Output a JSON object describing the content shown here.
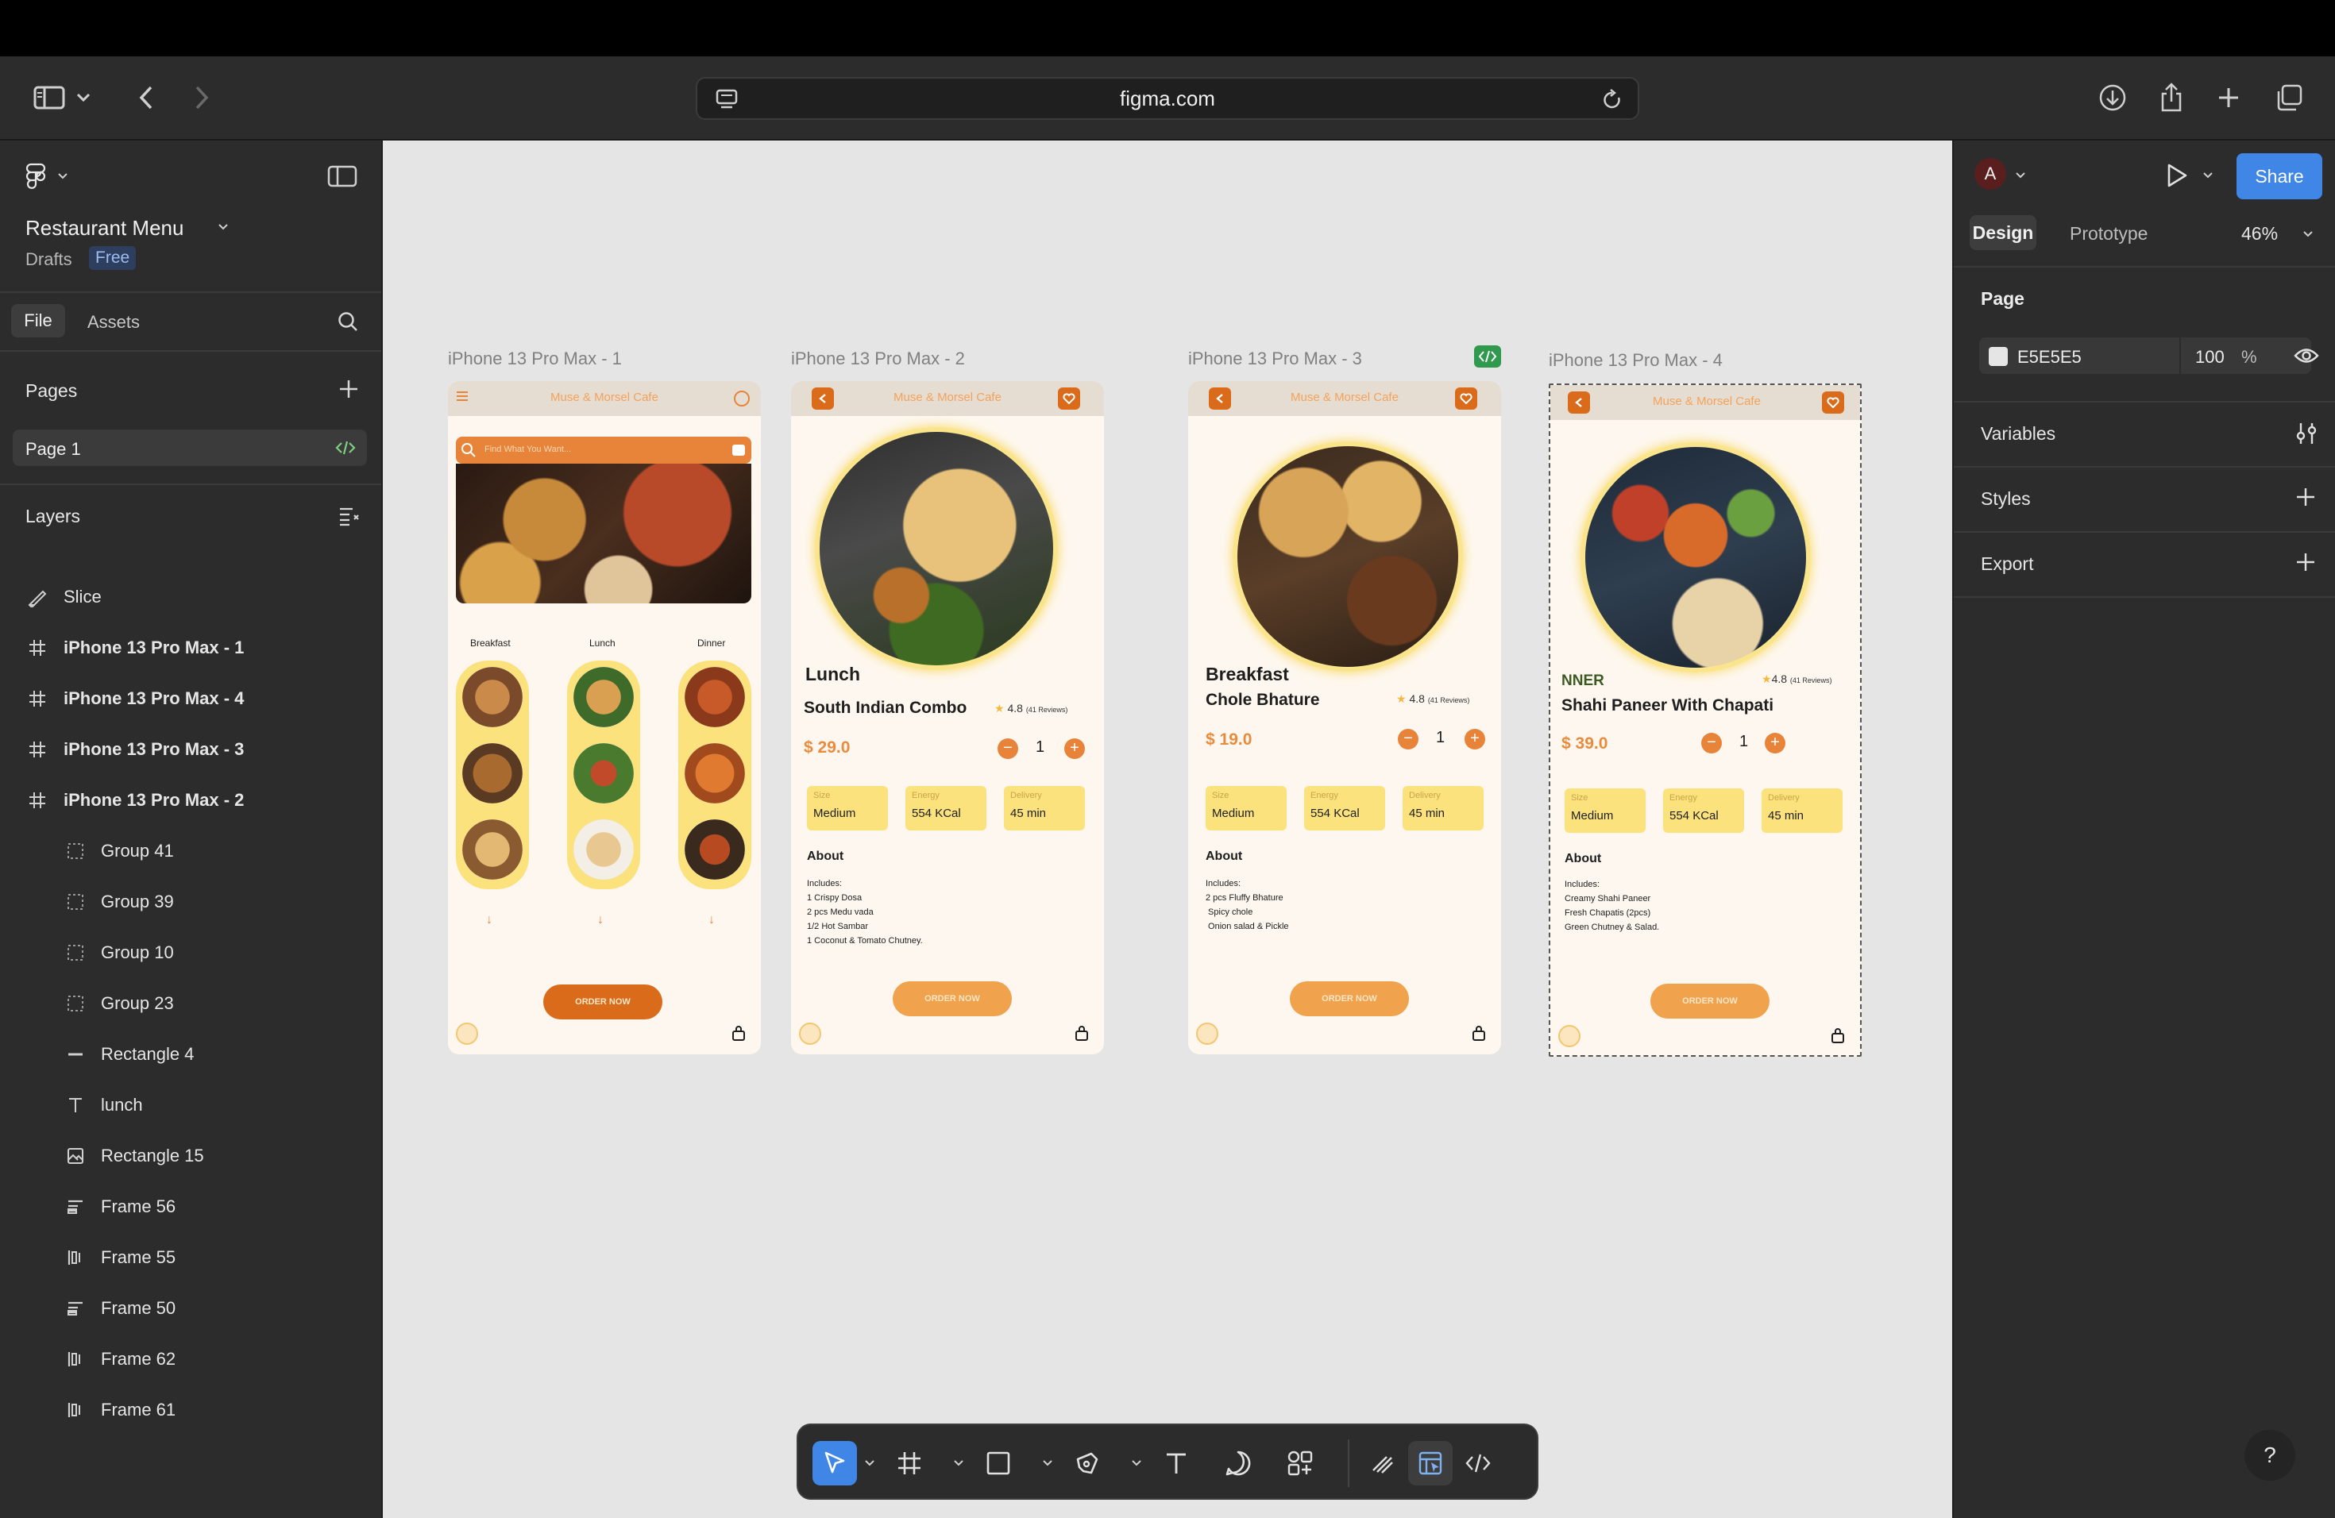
{
  "browser": {
    "url": "figma.com"
  },
  "file": {
    "name": "Restaurant Menu",
    "location": "Drafts",
    "plan_badge": "Free"
  },
  "left_panel": {
    "tabs": [
      "File",
      "Assets"
    ],
    "pages_title": "Pages",
    "current_page": "Page 1",
    "layers_title": "Layers",
    "layers": [
      {
        "label": "Slice",
        "icon": "slice-icon"
      },
      {
        "label": "iPhone 13 Pro Max - 1",
        "icon": "frame-icon"
      },
      {
        "label": "iPhone 13 Pro Max - 4",
        "icon": "frame-icon"
      },
      {
        "label": "iPhone 13 Pro Max - 3",
        "icon": "frame-icon"
      },
      {
        "label": "iPhone 13 Pro Max - 2",
        "icon": "frame-icon"
      },
      {
        "label": "Group 41",
        "icon": "group-icon"
      },
      {
        "label": "Group 39",
        "icon": "group-icon"
      },
      {
        "label": "Group 10",
        "icon": "group-icon"
      },
      {
        "label": "Group 23",
        "icon": "group-icon"
      },
      {
        "label": "Rectangle 4",
        "icon": "line-icon"
      },
      {
        "label": "lunch",
        "icon": "text-icon"
      },
      {
        "label": "Rectangle 15",
        "icon": "image-icon"
      },
      {
        "label": "Frame 56",
        "icon": "vertical-autolayout-icon"
      },
      {
        "label": "Frame 55",
        "icon": "horizontal-autolayout-icon"
      },
      {
        "label": "Frame 50",
        "icon": "vertical-autolayout-icon"
      },
      {
        "label": "Frame 62",
        "icon": "horizontal-autolayout-icon"
      },
      {
        "label": "Frame 61",
        "icon": "horizontal-autolayout-icon"
      }
    ]
  },
  "frames": [
    {
      "label": "iPhone 13 Pro Max - 1",
      "cafe": "Muse & Morsel Cafe",
      "search_placeholder": "Find What You Want...",
      "categories": [
        "Breakfast",
        "Lunch",
        "Dinner"
      ],
      "order": "ORDER NOW"
    },
    {
      "label": "iPhone 13 Pro Max - 2",
      "cafe": "Muse & Morsel Cafe",
      "category": "Lunch",
      "name": "South Indian Combo",
      "rating": "4.8",
      "reviews": "(41 Reviews)",
      "price": "$ 29.0",
      "qty": "1",
      "chips": [
        {
          "k": "Size",
          "v": "Medium"
        },
        {
          "k": "Energy",
          "v": "554 KCal"
        },
        {
          "k": "Delivery",
          "v": "45 min"
        }
      ],
      "about": "About",
      "about_text": "Includes:\n1 Crispy Dosa\n2 pcs Medu vada\n1/2 Hot Sambar\n1 Coconut & Tomato Chutney.",
      "order": "ORDER NOW"
    },
    {
      "label": "iPhone 13 Pro Max - 3",
      "cafe": "Muse & Morsel Cafe",
      "category": "Breakfast",
      "name": "Chole Bhature",
      "rating": "4.8",
      "reviews": "(41 Reviews)",
      "price": "$ 19.0",
      "qty": "1",
      "chips": [
        {
          "k": "Size",
          "v": "Medium"
        },
        {
          "k": "Energy",
          "v": "554 KCal"
        },
        {
          "k": "Delivery",
          "v": "45 min"
        }
      ],
      "about": "About",
      "about_text": "Includes:\n2 pcs Fluffy Bhature\n Spicy chole\n Onion salad & Pickle",
      "order": "ORDER NOW"
    },
    {
      "label": "iPhone 13 Pro Max - 4",
      "cafe": "Muse & Morsel Cafe",
      "category": "NNER",
      "name": "Shahi Paneer With Chapati",
      "rating": "4.8",
      "reviews": "(41 Reviews)",
      "price": "$ 39.0",
      "qty": "1",
      "chips": [
        {
          "k": "Size",
          "v": "Medium"
        },
        {
          "k": "Energy",
          "v": "554 KCal"
        },
        {
          "k": "Delivery",
          "v": "45 min"
        }
      ],
      "about": "About",
      "about_text": "Includes:\nCreamy Shahi Paneer\nFresh Chapatis (2pcs)\nGreen Chutney & Salad.",
      "order": "ORDER NOW"
    }
  ],
  "right_panel": {
    "avatar": "A",
    "share": "Share",
    "tabs": [
      "Design",
      "Prototype"
    ],
    "zoom": "46%",
    "page_section": "Page",
    "page_color": "E5E5E5",
    "page_opacity": "100",
    "percent": "%",
    "sections": [
      "Variables",
      "Styles",
      "Export"
    ]
  },
  "help": "?",
  "colors": {
    "accent": "#3f86e6",
    "canvas": "#E5E5E5",
    "brand_orange": "#e8843a",
    "chip_yellow": "#fbe27d"
  }
}
